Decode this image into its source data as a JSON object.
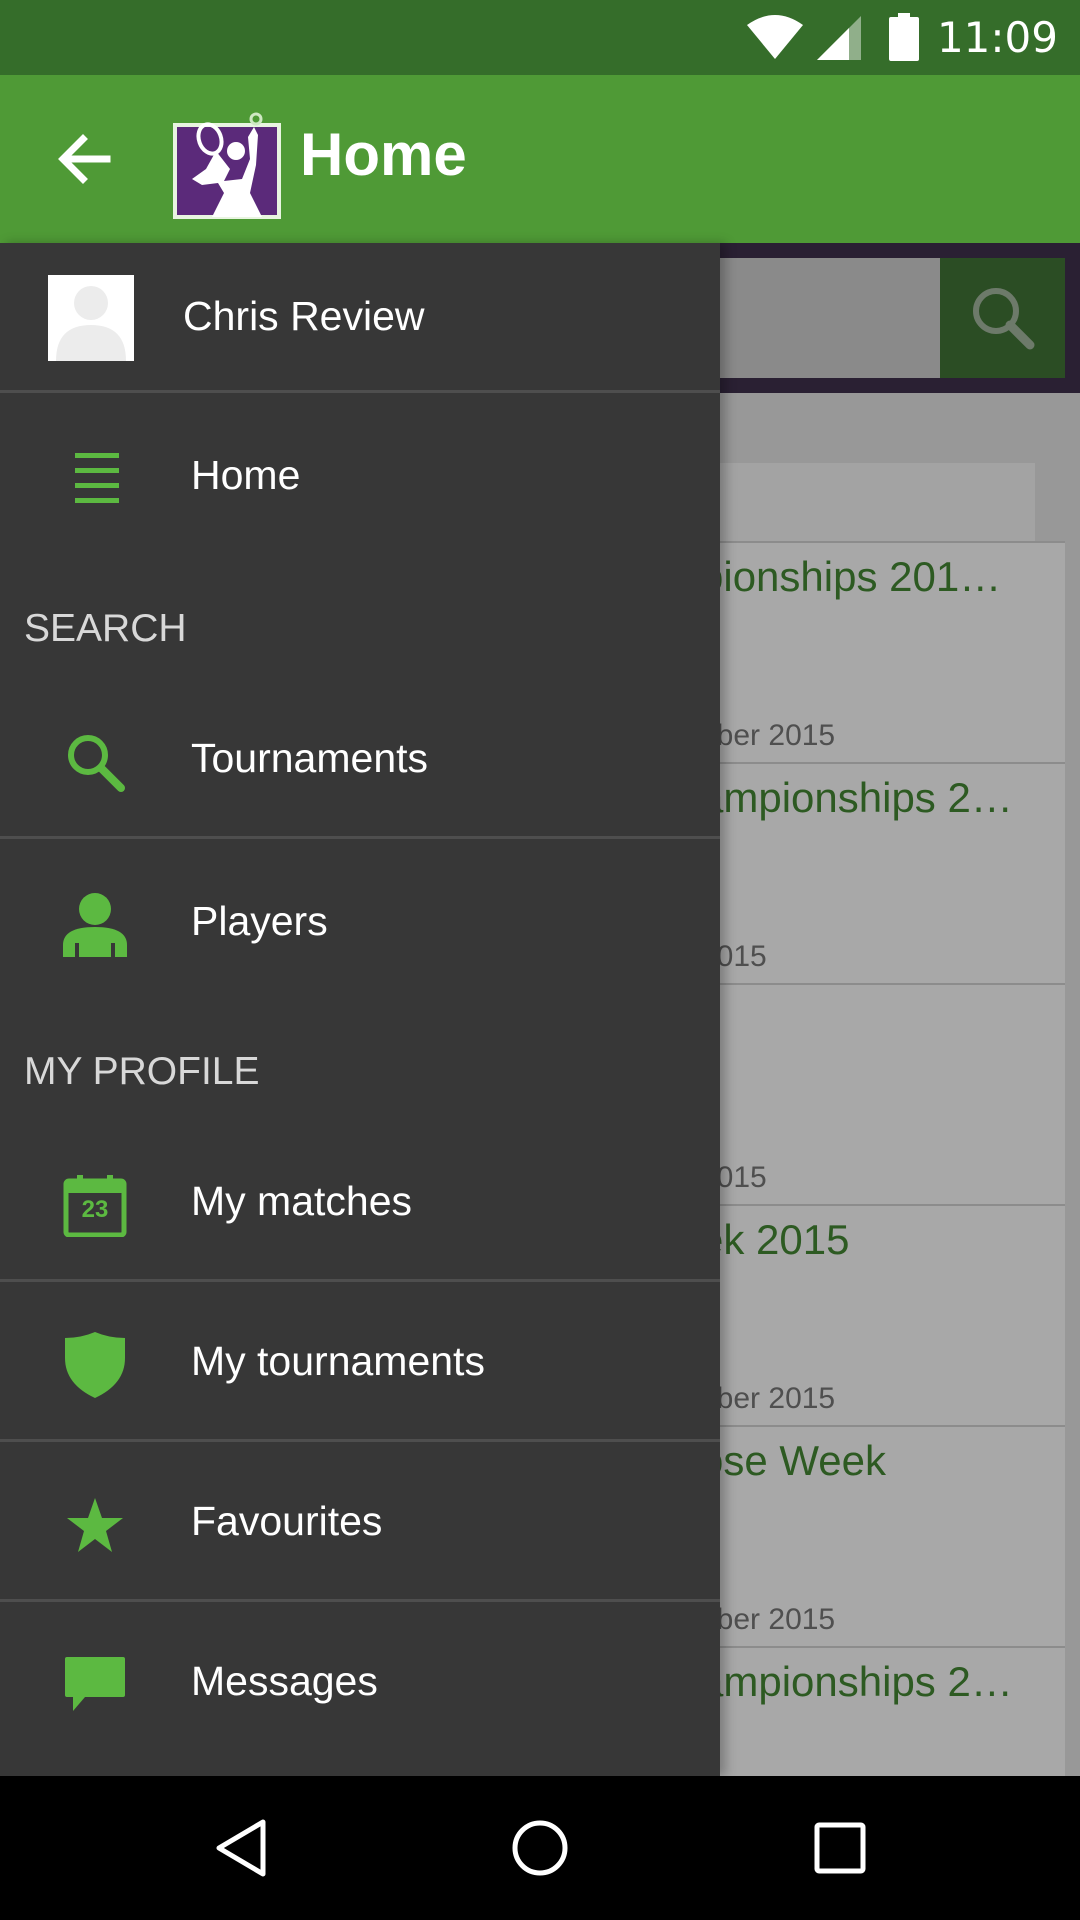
{
  "status_bar": {
    "time": "11:09",
    "icons": [
      "wifi-icon",
      "signal-icon",
      "battery-icon"
    ]
  },
  "toolbar": {
    "title": "Home",
    "back_icon": "arrow-back-icon",
    "logo": "tennis-player-logo"
  },
  "drawer": {
    "user_name": "Chris Review",
    "items": [
      {
        "label": "Home",
        "icon": "list-icon"
      },
      {
        "label": "Tournaments",
        "icon": "search-icon"
      },
      {
        "label": "Players",
        "icon": "person-icon"
      },
      {
        "label": "My matches",
        "icon": "calendar-icon",
        "icon_text": "23"
      },
      {
        "label": "My tournaments",
        "icon": "shield-icon"
      },
      {
        "label": "Favourites",
        "icon": "star-icon"
      },
      {
        "label": "Messages",
        "icon": "message-icon"
      }
    ],
    "sections": {
      "search": "SEARCH",
      "my_profile": "MY PROFILE"
    }
  },
  "background": {
    "cards": [
      {
        "title": "pionships 201…",
        "date": "nber 2015"
      },
      {
        "title": "ampionships 2…",
        "date": "2015"
      },
      {
        "title": "",
        "date": "2015"
      },
      {
        "title": "ek 2015",
        "date": "nber 2015"
      },
      {
        "title": "ose Week",
        "date": "nber 2015"
      },
      {
        "title": "ampionships 2…",
        "date": ""
      }
    ]
  },
  "colors": {
    "status_bar": "#356d2a",
    "toolbar": "#4f9a36",
    "drawer_bg": "#373737",
    "accent_green": "#5cb941"
  }
}
